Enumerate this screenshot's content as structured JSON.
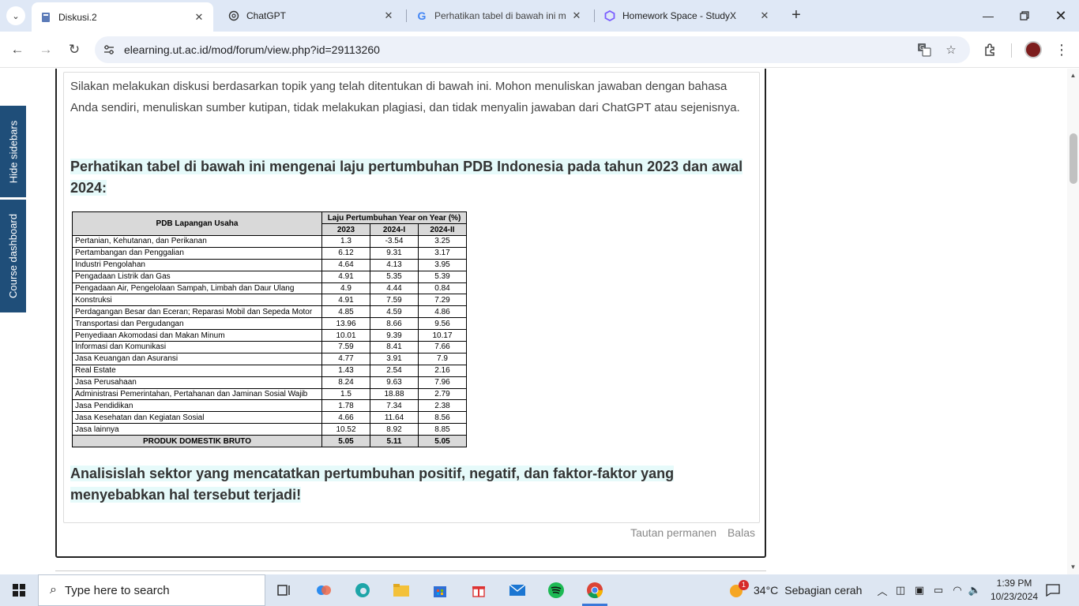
{
  "browser": {
    "tabs": [
      {
        "title": "Diskusi.2",
        "icon": "moodle-icon",
        "active": true
      },
      {
        "title": "ChatGPT",
        "icon": "openai-icon",
        "active": false
      },
      {
        "title": "Perhatikan tabel di bawah ini m",
        "icon": "google-icon",
        "active": false
      },
      {
        "title": "Homework Space - StudyX",
        "icon": "studyx-icon",
        "active": false
      }
    ],
    "url": "elearning.ut.ac.id/mod/forum/view.php?id=29113260"
  },
  "sidebar": {
    "hide_sidebars": "Hide sidebars",
    "course_dashboard": "Course dashboard"
  },
  "post": {
    "intro": "Silakan melakukan diskusi berdasarkan topik yang telah ditentukan di bawah ini. Mohon menuliskan jawaban dengan bahasa Anda sendiri, menuliskan sumber kutipan, tidak melakukan plagiasi, dan tidak menyalin jawaban dari ChatGPT atau sejenisnya.",
    "question1": "Perhatikan tabel di bawah ini mengenai laju pertumbuhan PDB Indonesia pada tahun 2023 dan awal 2024:",
    "question2": "Analisislah sektor yang mencatatkan pertumbuhan positif, negatif, dan faktor-faktor yang menyebabkan hal tersebut terjadi!",
    "permalink": "Tautan permanen",
    "reply": "Balas"
  },
  "table": {
    "col_sector": "PDB Lapangan Usaha",
    "col_group": "Laju Pertumbuhan Year on Year (%)",
    "years": [
      "2023",
      "2024-I",
      "2024-II"
    ],
    "rows": [
      {
        "sector": "Pertanian, Kehutanan, dan Perikanan",
        "v": [
          "1.3",
          "-3.54",
          "3.25"
        ]
      },
      {
        "sector": "Pertambangan dan Penggalian",
        "v": [
          "6.12",
          "9.31",
          "3.17"
        ]
      },
      {
        "sector": "Industri Pengolahan",
        "v": [
          "4.64",
          "4.13",
          "3.95"
        ]
      },
      {
        "sector": "Pengadaan Listrik dan Gas",
        "v": [
          "4.91",
          "5.35",
          "5.39"
        ]
      },
      {
        "sector": "Pengadaan Air, Pengelolaan Sampah, Limbah dan Daur Ulang",
        "v": [
          "4.9",
          "4.44",
          "0.84"
        ]
      },
      {
        "sector": "Konstruksi",
        "v": [
          "4.91",
          "7.59",
          "7.29"
        ]
      },
      {
        "sector": "Perdagangan Besar dan Eceran; Reparasi Mobil dan Sepeda Motor",
        "v": [
          "4.85",
          "4.59",
          "4.86"
        ]
      },
      {
        "sector": "Transportasi dan Pergudangan",
        "v": [
          "13.96",
          "8.66",
          "9.56"
        ]
      },
      {
        "sector": "Penyediaan Akomodasi dan Makan Minum",
        "v": [
          "10.01",
          "9.39",
          "10.17"
        ]
      },
      {
        "sector": "Informasi dan Komunikasi",
        "v": [
          "7.59",
          "8.41",
          "7.66"
        ]
      },
      {
        "sector": "Jasa Keuangan dan Asuransi",
        "v": [
          "4.77",
          "3.91",
          "7.9"
        ]
      },
      {
        "sector": "Real Estate",
        "v": [
          "1.43",
          "2.54",
          "2.16"
        ]
      },
      {
        "sector": "Jasa Perusahaan",
        "v": [
          "8.24",
          "9.63",
          "7.96"
        ]
      },
      {
        "sector": "Administrasi Pemerintahan, Pertahanan dan Jaminan Sosial Wajib",
        "v": [
          "1.5",
          "18.88",
          "2.79"
        ]
      },
      {
        "sector": "Jasa Pendidikan",
        "v": [
          "1.78",
          "7.34",
          "2.38"
        ]
      },
      {
        "sector": "Jasa Kesehatan dan Kegiatan Sosial",
        "v": [
          "4.66",
          "11.64",
          "8.56"
        ]
      },
      {
        "sector": "Jasa lainnya",
        "v": [
          "10.52",
          "8.92",
          "8.85"
        ]
      }
    ],
    "total": {
      "sector": "PRODUK DOMESTIK BRUTO",
      "v": [
        "5.05",
        "5.11",
        "5.05"
      ]
    }
  },
  "taskbar": {
    "search_placeholder": "Type here to search",
    "weather_temp": "34°C",
    "weather_text": "Sebagian cerah",
    "weather_badge": "1",
    "time": "1:39 PM",
    "date": "10/23/2024"
  }
}
